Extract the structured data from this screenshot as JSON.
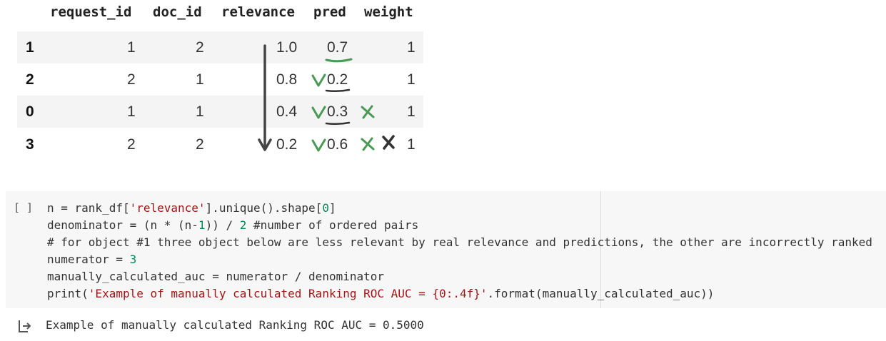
{
  "table": {
    "columns": [
      "request_id",
      "doc_id",
      "relevance",
      "pred",
      "weight"
    ],
    "rows": [
      {
        "index": "1",
        "request_id": "1",
        "doc_id": "2",
        "relevance": "1.0",
        "pred": "0.7",
        "weight": "1"
      },
      {
        "index": "2",
        "request_id": "2",
        "doc_id": "1",
        "relevance": "0.8",
        "pred": "0.2",
        "weight": "1"
      },
      {
        "index": "0",
        "request_id": "1",
        "doc_id": "1",
        "relevance": "0.4",
        "pred": "0.3",
        "weight": "1"
      },
      {
        "index": "3",
        "request_id": "2",
        "doc_id": "2",
        "relevance": "0.2",
        "pred": "0.6",
        "weight": "1"
      }
    ]
  },
  "annotations": {
    "pen_color": "#4a9a55",
    "arrow_color": "#444444"
  },
  "code_cell": {
    "run_indicator": "[ ]",
    "lines": {
      "l1_a": "n = rank_df[",
      "l1_str": "'relevance'",
      "l1_b": "].unique().shape[",
      "l1_num": "0",
      "l1_c": "]",
      "l2_a": "denominator = (n * (n-",
      "l2_num1": "1",
      "l2_b": ")) / ",
      "l2_num2": "2",
      "l2_c": " #number of ordered pairs",
      "l3": "# for object #1 three object below are less relevant by real relevance and predictions, the other are incorrectly ranked",
      "l4_a": "numerator = ",
      "l4_num": "3",
      "l5": "manually_calculated_auc = numerator / denominator",
      "l6_a": "print(",
      "l6_str": "'Example of manually calculated Ranking ROC AUC = {0:.4f}'",
      "l6_b": ".format(manually_calculated_auc))"
    }
  },
  "output": {
    "icon": "output-arrow-icon",
    "text": "Example of manually calculated Ranking ROC AUC = 0.5000"
  }
}
